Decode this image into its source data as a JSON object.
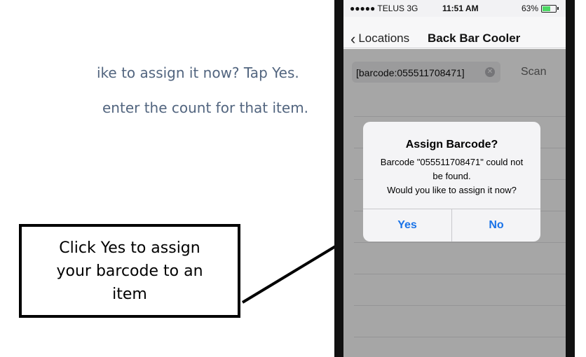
{
  "instructions": {
    "line1": "ike to assign it now? Tap Yes.",
    "line2": "enter the count for that item."
  },
  "callout": {
    "text": "Click Yes to assign your barcode to an item"
  },
  "phone": {
    "status_bar": {
      "carrier": "●●●●● TELUS  3G",
      "time": "11:51 AM",
      "battery": "63%",
      "battery_level": 0.63
    },
    "nav": {
      "back_label": "Locations",
      "title": "Back Bar Cooler"
    },
    "search": {
      "value": "[barcode:055511708471]",
      "scan_label": "Scan"
    },
    "alert": {
      "title": "Assign Barcode?",
      "message_line1": "Barcode \"055511708471\" could not",
      "message_line2": "be found.",
      "message_line3": "Would you like to assign it now?",
      "yes_label": "Yes",
      "no_label": "No"
    },
    "colors": {
      "accent": "#1a73e8",
      "battery_green": "#4cd964"
    }
  }
}
